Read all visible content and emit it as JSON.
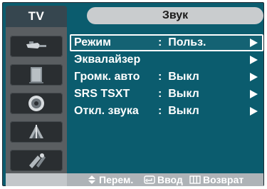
{
  "header": {
    "tv_tab": "TV",
    "title": "Звук"
  },
  "sidebar": {
    "icons": [
      "antenna-plug-icon",
      "picture-panel-icon",
      "speaker-icon",
      "channel-dish-icon",
      "setup-tools-icon"
    ]
  },
  "menu": {
    "items": [
      {
        "label": "Режим",
        "value": "Польз.",
        "selected": true
      },
      {
        "label": "Эквалайзер",
        "value": "",
        "selected": false
      },
      {
        "label": "Громк. авто",
        "value": "Выкл",
        "selected": false
      },
      {
        "label": "SRS TSXT",
        "value": "Выкл",
        "selected": false
      },
      {
        "label": "Откл. звука",
        "value": "Выкл",
        "selected": false
      }
    ],
    "separator": ":"
  },
  "footer": {
    "move": "Перем.",
    "enter": "Ввод",
    "return": "Возврат"
  },
  "colors": {
    "frame": "#0b5c6e",
    "tab": "#36464f",
    "sidebar": "#5a5e61",
    "pill": "#c9ccce",
    "footer": "#aeb3b7"
  }
}
